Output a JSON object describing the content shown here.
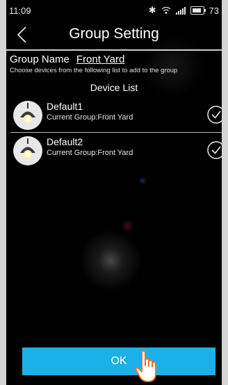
{
  "status_bar": {
    "time": "11:09",
    "battery_level": "73",
    "icons": [
      "bluetooth-icon",
      "wifi-icon",
      "signal-icon",
      "battery-icon"
    ]
  },
  "header": {
    "title": "Group Setting",
    "back_icon": "chevron-left-icon"
  },
  "group": {
    "name_label": "Group Name",
    "name_value": "Front Yard",
    "hint": "Choose devices from the following list to add to the group"
  },
  "device_list": {
    "title": "Device List",
    "items": [
      {
        "name": "Default1",
        "group": "Current Group:Front Yard",
        "checked": true,
        "icon": "bulb-icon"
      },
      {
        "name": "Default2",
        "group": "Current Group:Front Yard",
        "checked": true,
        "icon": "bulb-icon"
      }
    ]
  },
  "footer": {
    "ok_label": "OK",
    "pointer_icon": "hand-pointer-icon"
  },
  "colors": {
    "background": "#000000",
    "accent": "#1bb0e8",
    "pointer_outline": "#e8742a"
  }
}
